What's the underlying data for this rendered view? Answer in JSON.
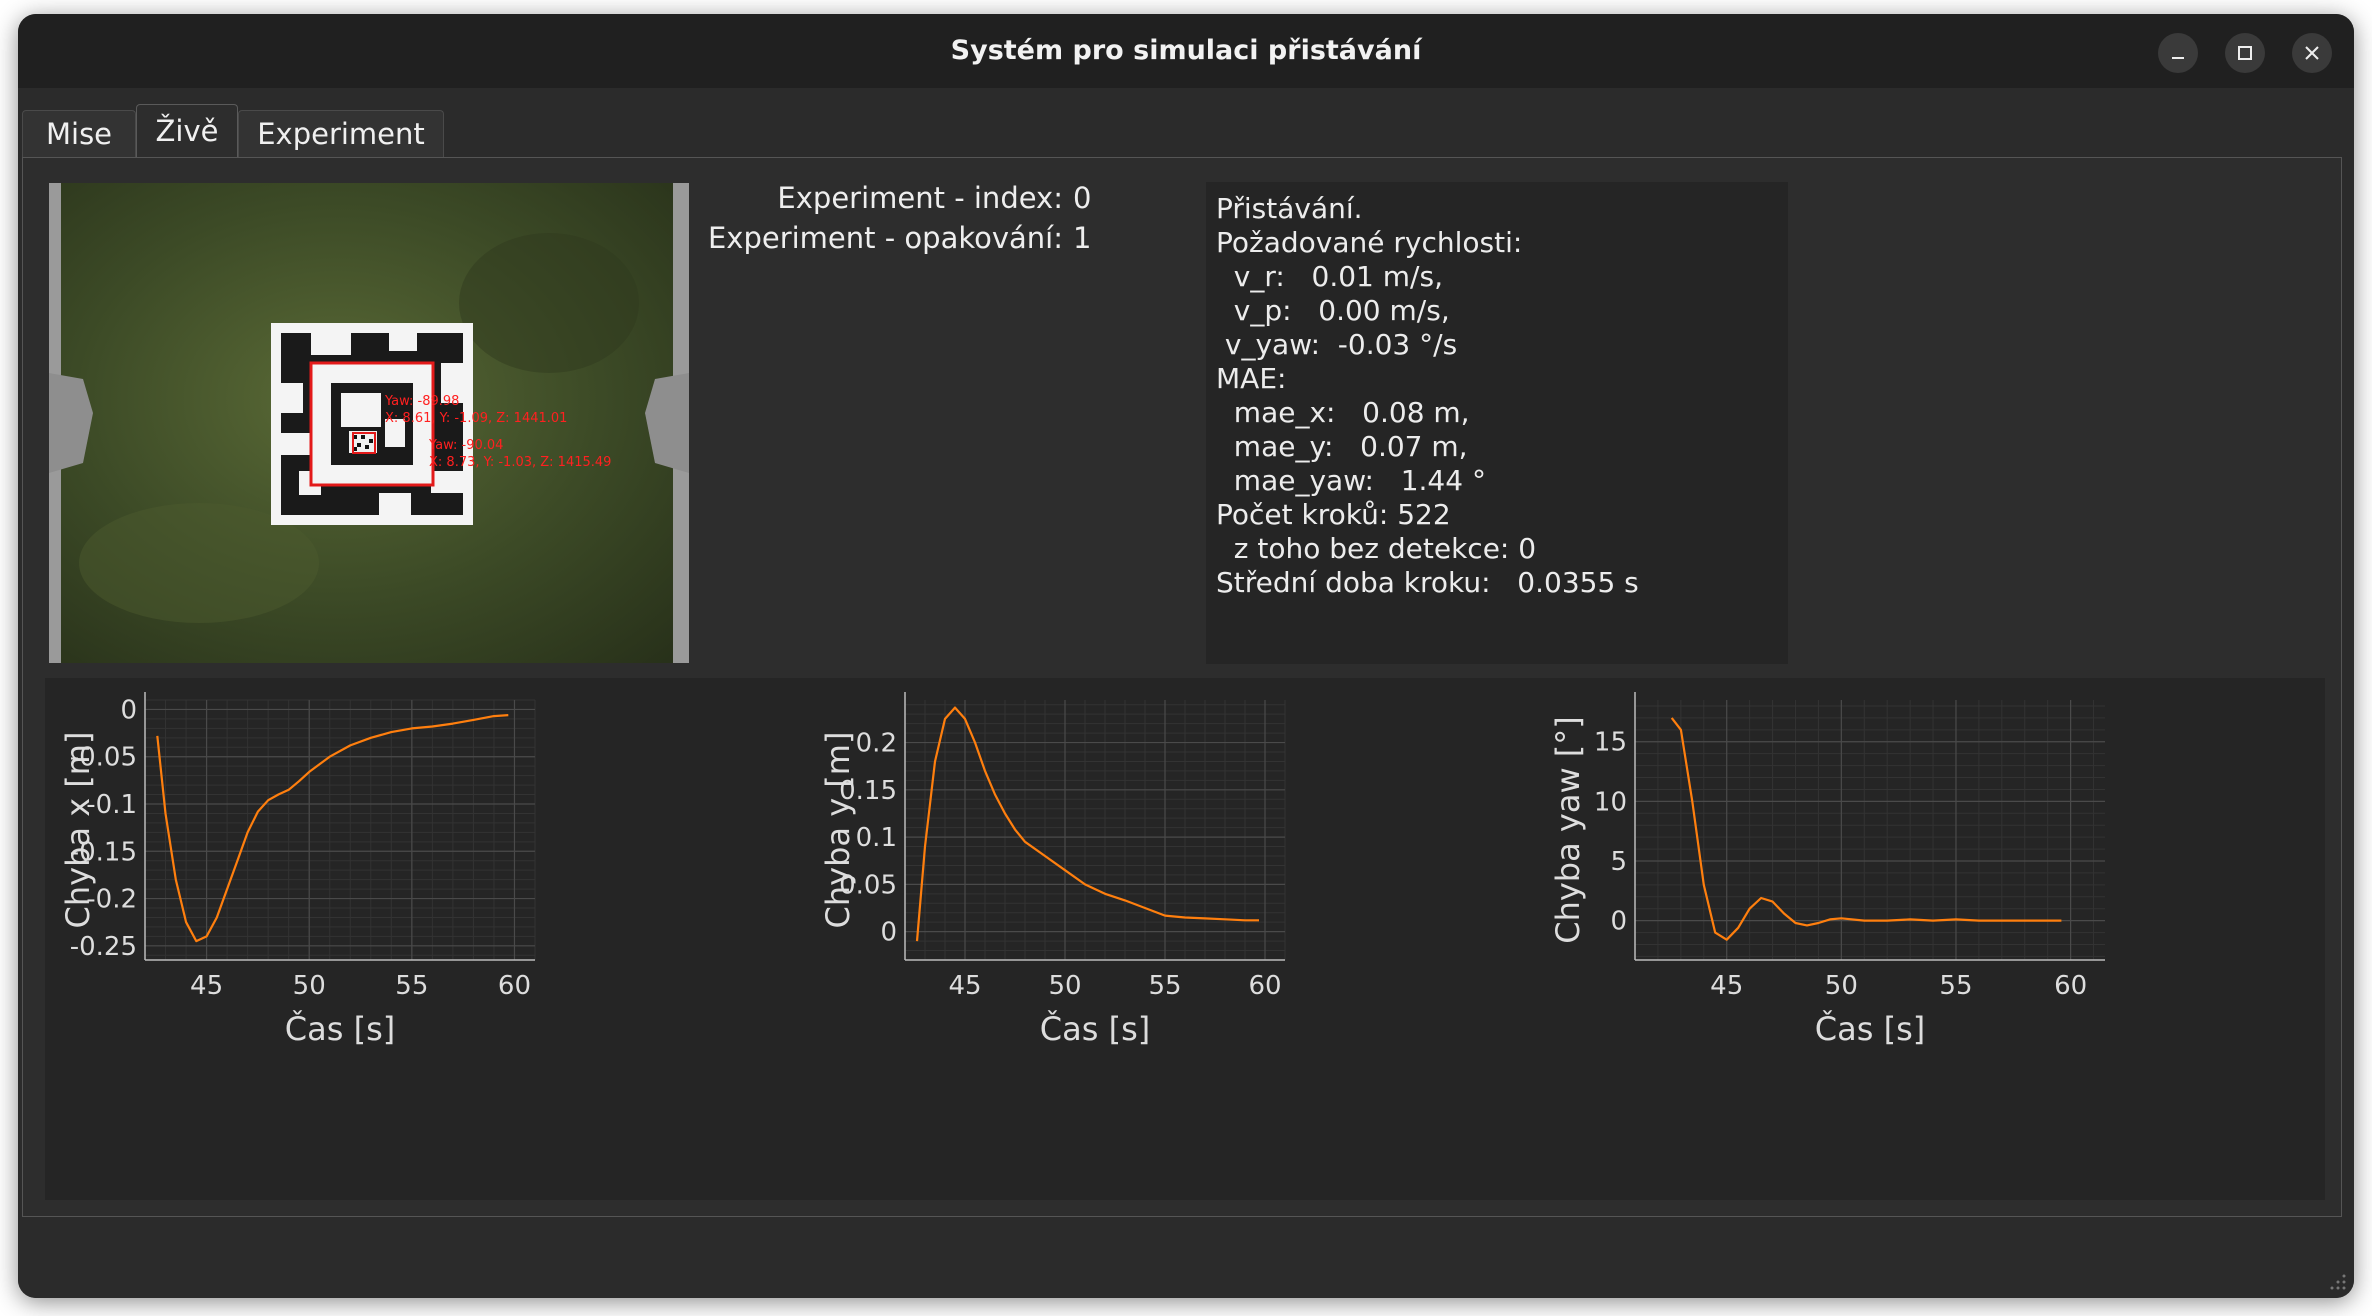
{
  "window": {
    "title": "Systém pro simulaci přistávání"
  },
  "tabs": [
    {
      "label": "Mise",
      "active": false
    },
    {
      "label": "Živě",
      "active": true
    },
    {
      "label": "Experiment",
      "active": false
    }
  ],
  "experiment": {
    "index_label": "Experiment - index:",
    "index_value": "0",
    "repeat_label": "Experiment - opakování:",
    "repeat_value": "1"
  },
  "camera": {
    "overlay_lines": [
      "Yaw: -89.98",
      "X: 8.61, Y: -1.09, Z: 1441.01",
      "Yaw: -90.04",
      "X: 8.73, Y: -1.03, Z: 1415.49"
    ]
  },
  "status": {
    "lines": [
      "Přistávání.",
      "Požadované rychlosti:",
      "  v_r:   0.01 m/s,",
      "  v_p:   0.00 m/s,",
      " v_yaw:  -0.03 °/s",
      "MAE:",
      "  mae_x:   0.08 m,",
      "  mae_y:   0.07 m,",
      "  mae_yaw:   1.44 °",
      "Počet kroků: 522",
      "  z toho bez detekce: 0",
      "Střední doba kroku:   0.0355 s"
    ]
  },
  "colors": {
    "series": "#ff7f0e",
    "plot_bg": "#252525",
    "grid": "#3c3c3c",
    "text": "#dddddd"
  },
  "chart_data": [
    {
      "type": "line",
      "xlabel": "Čas [s]",
      "ylabel": "Chyba x [m]",
      "xlim": [
        42,
        61
      ],
      "ylim": [
        -0.265,
        0.01
      ],
      "xticks": [
        45,
        50,
        55,
        60
      ],
      "yticks": [
        0,
        -0.05,
        -0.1,
        -0.15,
        -0.2,
        -0.25
      ],
      "ytick_labels": [
        "0",
        "-0.05",
        "-0.1",
        "-0.15",
        "-0.2",
        "-0.25"
      ],
      "grid": true,
      "x": [
        42.6,
        43.0,
        43.5,
        44.0,
        44.5,
        45.0,
        45.5,
        46.0,
        46.5,
        47.0,
        47.5,
        48.0,
        48.5,
        49.0,
        49.5,
        50.0,
        51.0,
        52.0,
        53.0,
        54.0,
        55.0,
        56.0,
        57.0,
        58.0,
        59.0,
        59.7
      ],
      "y": [
        -0.028,
        -0.11,
        -0.18,
        -0.225,
        -0.245,
        -0.24,
        -0.22,
        -0.19,
        -0.16,
        -0.13,
        -0.108,
        -0.096,
        -0.09,
        -0.085,
        -0.076,
        -0.066,
        -0.05,
        -0.038,
        -0.03,
        -0.024,
        -0.02,
        -0.018,
        -0.015,
        -0.011,
        -0.007,
        -0.006
      ]
    },
    {
      "type": "line",
      "xlabel": "Čas [s]",
      "ylabel": "Chyba y [m]",
      "xlim": [
        42,
        61
      ],
      "ylim": [
        -0.03,
        0.245
      ],
      "xticks": [
        45,
        50,
        55,
        60
      ],
      "yticks": [
        0,
        0.05,
        0.1,
        0.15,
        0.2
      ],
      "ytick_labels": [
        "0",
        "0.05",
        "0.1",
        "0.15",
        "0.2"
      ],
      "grid": true,
      "x": [
        42.6,
        43.0,
        43.5,
        44.0,
        44.5,
        45.0,
        45.5,
        46.0,
        46.5,
        47.0,
        47.5,
        48.0,
        49.0,
        50.0,
        51.0,
        52.0,
        53.0,
        54.0,
        55.0,
        56.0,
        57.0,
        58.0,
        59.0,
        59.7
      ],
      "y": [
        -0.01,
        0.09,
        0.18,
        0.225,
        0.237,
        0.225,
        0.2,
        0.17,
        0.145,
        0.125,
        0.108,
        0.095,
        0.08,
        0.065,
        0.05,
        0.04,
        0.033,
        0.025,
        0.017,
        0.015,
        0.014,
        0.013,
        0.012,
        0.012
      ]
    },
    {
      "type": "line",
      "xlabel": "Čas [s]",
      "ylabel": "Chyba yaw [°]",
      "xlim": [
        41,
        61.5
      ],
      "ylim": [
        -3.3,
        18.5
      ],
      "xticks": [
        45,
        50,
        55,
        60
      ],
      "yticks": [
        0,
        5,
        10,
        15
      ],
      "ytick_labels": [
        "0",
        "5",
        "10",
        "15"
      ],
      "grid": true,
      "x": [
        42.6,
        43.0,
        43.5,
        44.0,
        44.5,
        45.0,
        45.5,
        46.0,
        46.5,
        47.0,
        47.5,
        48.0,
        48.5,
        49.0,
        49.5,
        50.0,
        51.0,
        52.0,
        53.0,
        54.0,
        55.0,
        56.0,
        57.0,
        58.0,
        59.0,
        59.6
      ],
      "y": [
        17.0,
        16.0,
        10.0,
        3.0,
        -1.0,
        -1.6,
        -0.6,
        1.0,
        1.9,
        1.6,
        0.6,
        -0.2,
        -0.4,
        -0.2,
        0.1,
        0.2,
        0.0,
        0.0,
        0.1,
        0.0,
        0.1,
        0.0,
        0.0,
        0.0,
        0.0,
        0.0
      ]
    }
  ]
}
